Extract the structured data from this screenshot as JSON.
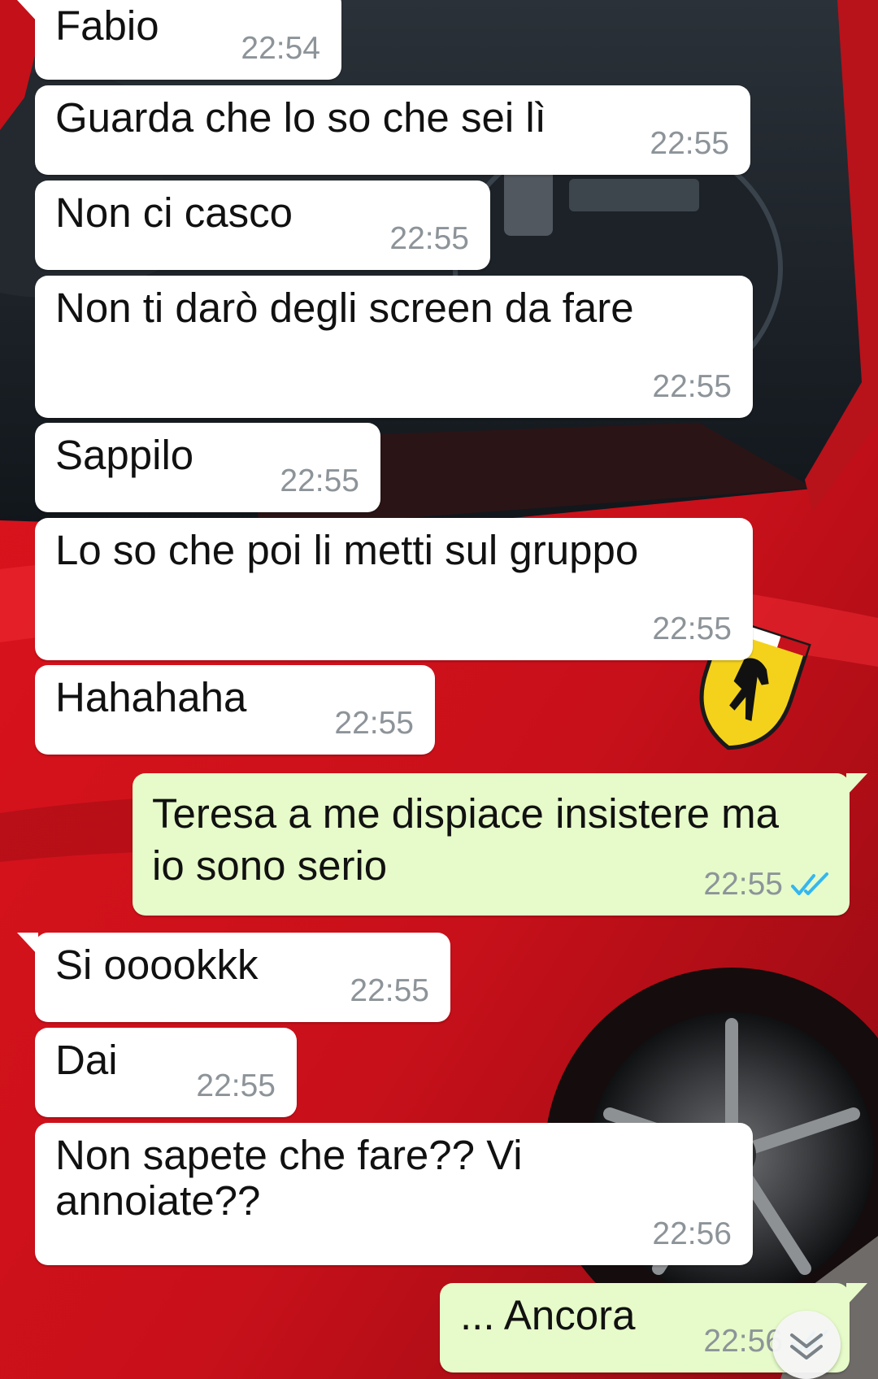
{
  "messages": [
    {
      "text": "Fabio",
      "time": "22:54",
      "dir": "in"
    },
    {
      "text": "Guarda che lo so che sei lì",
      "time": "22:55",
      "dir": "in"
    },
    {
      "text": "Non ci casco",
      "time": "22:55",
      "dir": "in"
    },
    {
      "text": "Non ti darò degli screen da fare",
      "time": "22:55",
      "dir": "in"
    },
    {
      "text": "Sappilo",
      "time": "22:55",
      "dir": "in"
    },
    {
      "text": "Lo so che poi li metti sul gruppo",
      "time": "22:55",
      "dir": "in"
    },
    {
      "text": "Hahahaha",
      "time": "22:55",
      "dir": "in"
    },
    {
      "text": "Teresa a me dispiace insistere ma io sono serio",
      "line1": "Teresa a me dispiace insistere ma",
      "line2": "io sono serio",
      "time": "22:55",
      "dir": "out",
      "status": "read"
    },
    {
      "text": "Si ooookkk",
      "time": "22:55",
      "dir": "in"
    },
    {
      "text": "Dai",
      "time": "22:55",
      "dir": "in"
    },
    {
      "text": "Non sapete che fare?? Vi annoiate??",
      "line1": "Non sapete che fare?? Vi",
      "line2": "annoiate??",
      "time": "22:56",
      "dir": "in"
    },
    {
      "text": "... Ancora",
      "time": "22:56",
      "dir": "out",
      "status": "read"
    }
  ],
  "colors": {
    "incoming_bubble": "#ffffff",
    "outgoing_bubble": "#e6fbc9",
    "timestamp": "#8d9499",
    "read_ticks": "#34b7f1",
    "wallpaper_car": "#d8141c"
  },
  "icons": {
    "read_receipt": "double-check-icon",
    "scroll_down": "double-chevron-down-icon"
  }
}
